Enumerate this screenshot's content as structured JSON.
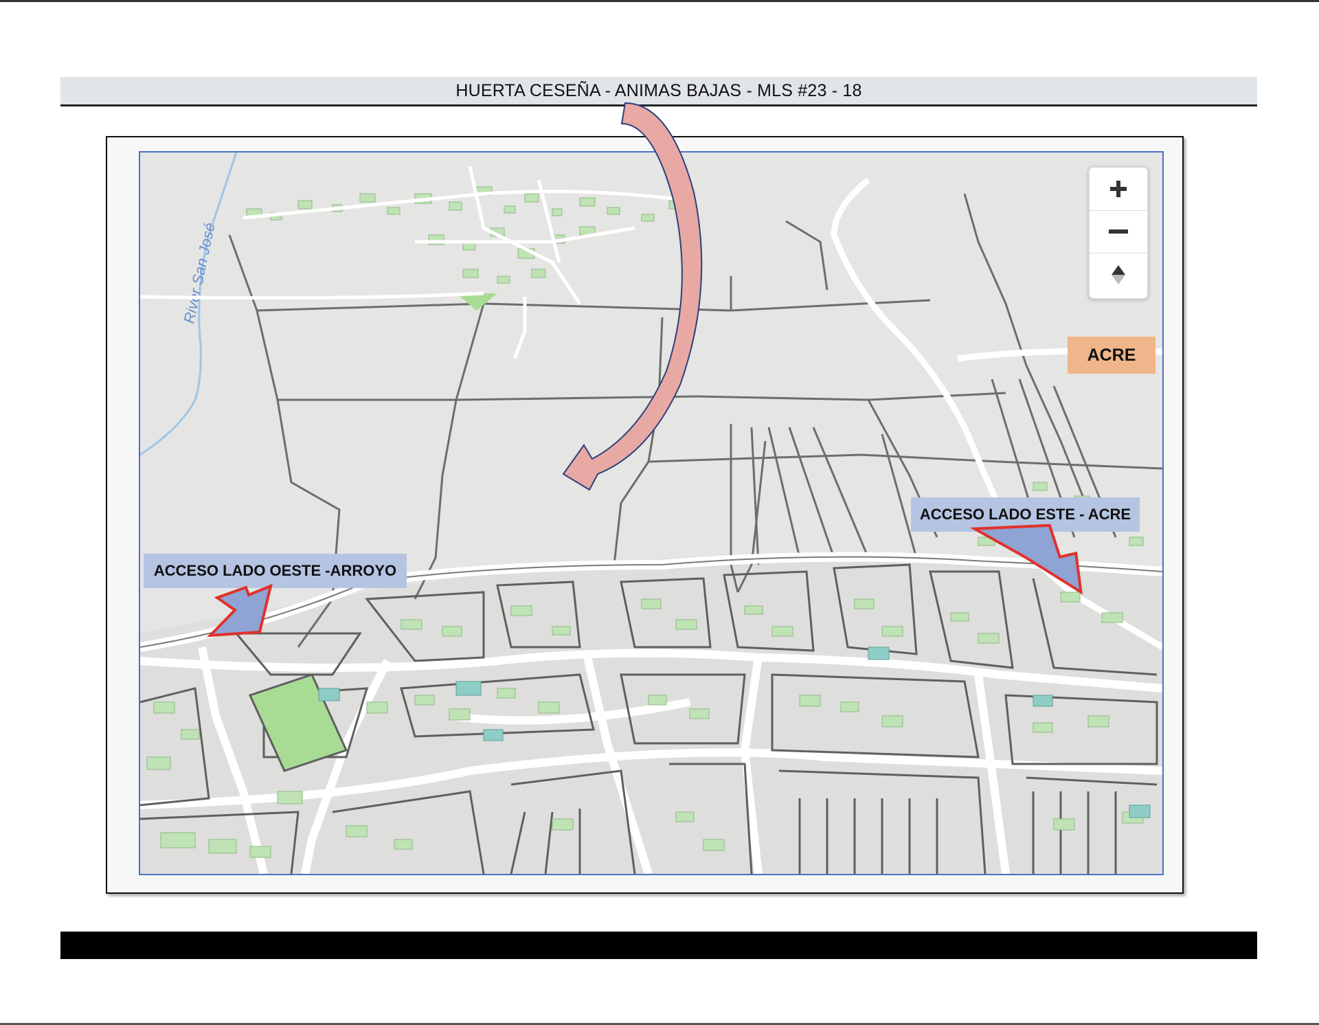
{
  "header": {
    "title": "HUERTA CESEÑA - ANIMAS BAJAS - MLS #23 - 18"
  },
  "map": {
    "river_label": "River San José",
    "zoom_controls": {
      "zoom_in_icon": "plus-icon",
      "zoom_out_icon": "minus-icon",
      "compass_icon": "compass-icon"
    }
  },
  "annotations": {
    "acre": "ACRE",
    "east_access": "ACCESO LADO ESTE  - ACRE",
    "west_access": "ACCESO LADO OESTE  -ARROYO"
  },
  "colors": {
    "header_bg": "#e1e4e8",
    "acre_label_bg": "#f0b58a",
    "access_label_bg": "#b4c4e2",
    "curved_arrow_fill": "#e8a9a4",
    "access_arrow_fill": "#8fa3d4",
    "access_arrow_border": "#e0322a",
    "building": "#bfe3b4",
    "park": "#a8dc94",
    "river": "#9cc6ea"
  }
}
